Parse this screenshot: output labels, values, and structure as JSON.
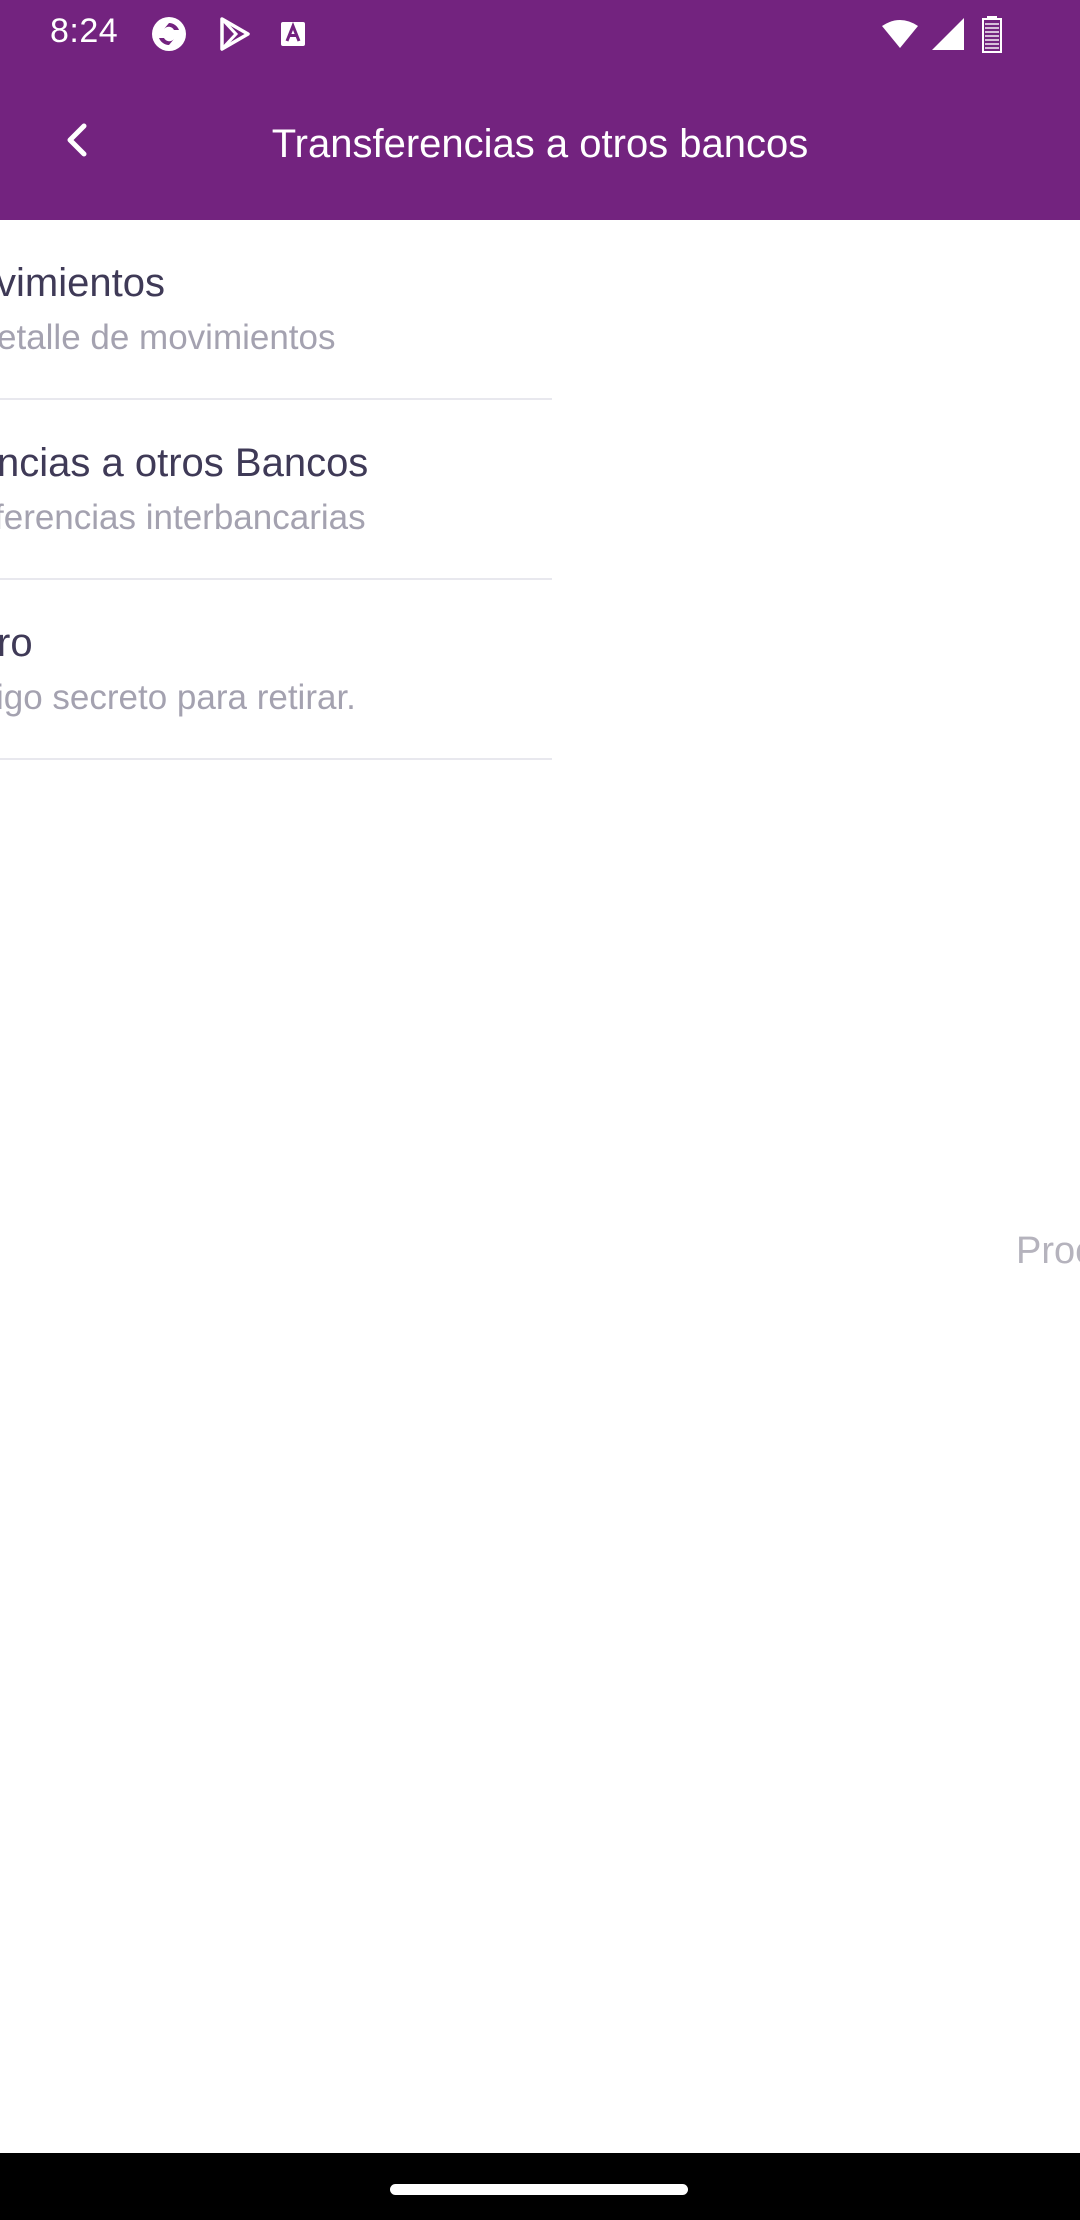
{
  "status_bar": {
    "time": "8:24",
    "left_icons": [
      "sync-app-icon",
      "play-store-icon",
      "font-app-icon"
    ],
    "right_icons": [
      "wifi-icon",
      "signal-icon",
      "battery-icon"
    ]
  },
  "app_bar": {
    "title": "Transferencias a otros bancos",
    "back_icon": "chevron-left-icon",
    "background_color": "#73237f"
  },
  "menu": {
    "items": [
      {
        "title": "vimientos",
        "subtitle": "etalle de movimientos"
      },
      {
        "title": "ncias a otros Bancos",
        "subtitle": "ferencias interbancarias"
      },
      {
        "title": "ro",
        "subtitle": "igo secreto para retirar."
      }
    ]
  },
  "side_panel": {
    "text": "Proc"
  },
  "nav_bar": {
    "home_indicator": "home-indicator"
  }
}
